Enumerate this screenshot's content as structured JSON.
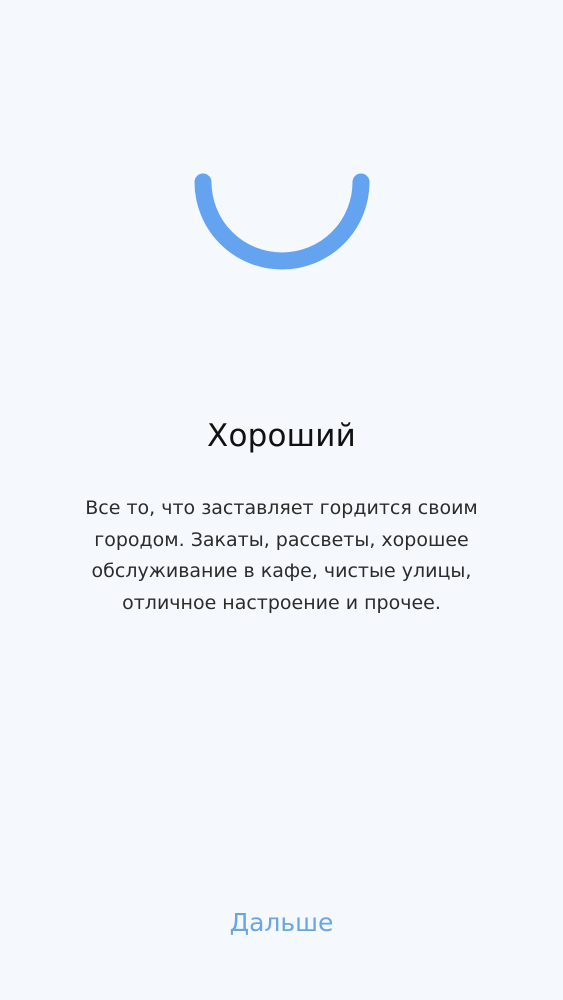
{
  "mood": {
    "icon": "smile-arc-icon",
    "accent_color": "#64a3f0",
    "title": "Хороший",
    "description": "Все то, что заставляет гордится своим городом. Закаты, рассветы, хорошее обслуживание в кафе, чистые улицы, отличное настроение и прочее."
  },
  "footer": {
    "next_label": "Дальше",
    "next_color": "#6aa6e2"
  }
}
